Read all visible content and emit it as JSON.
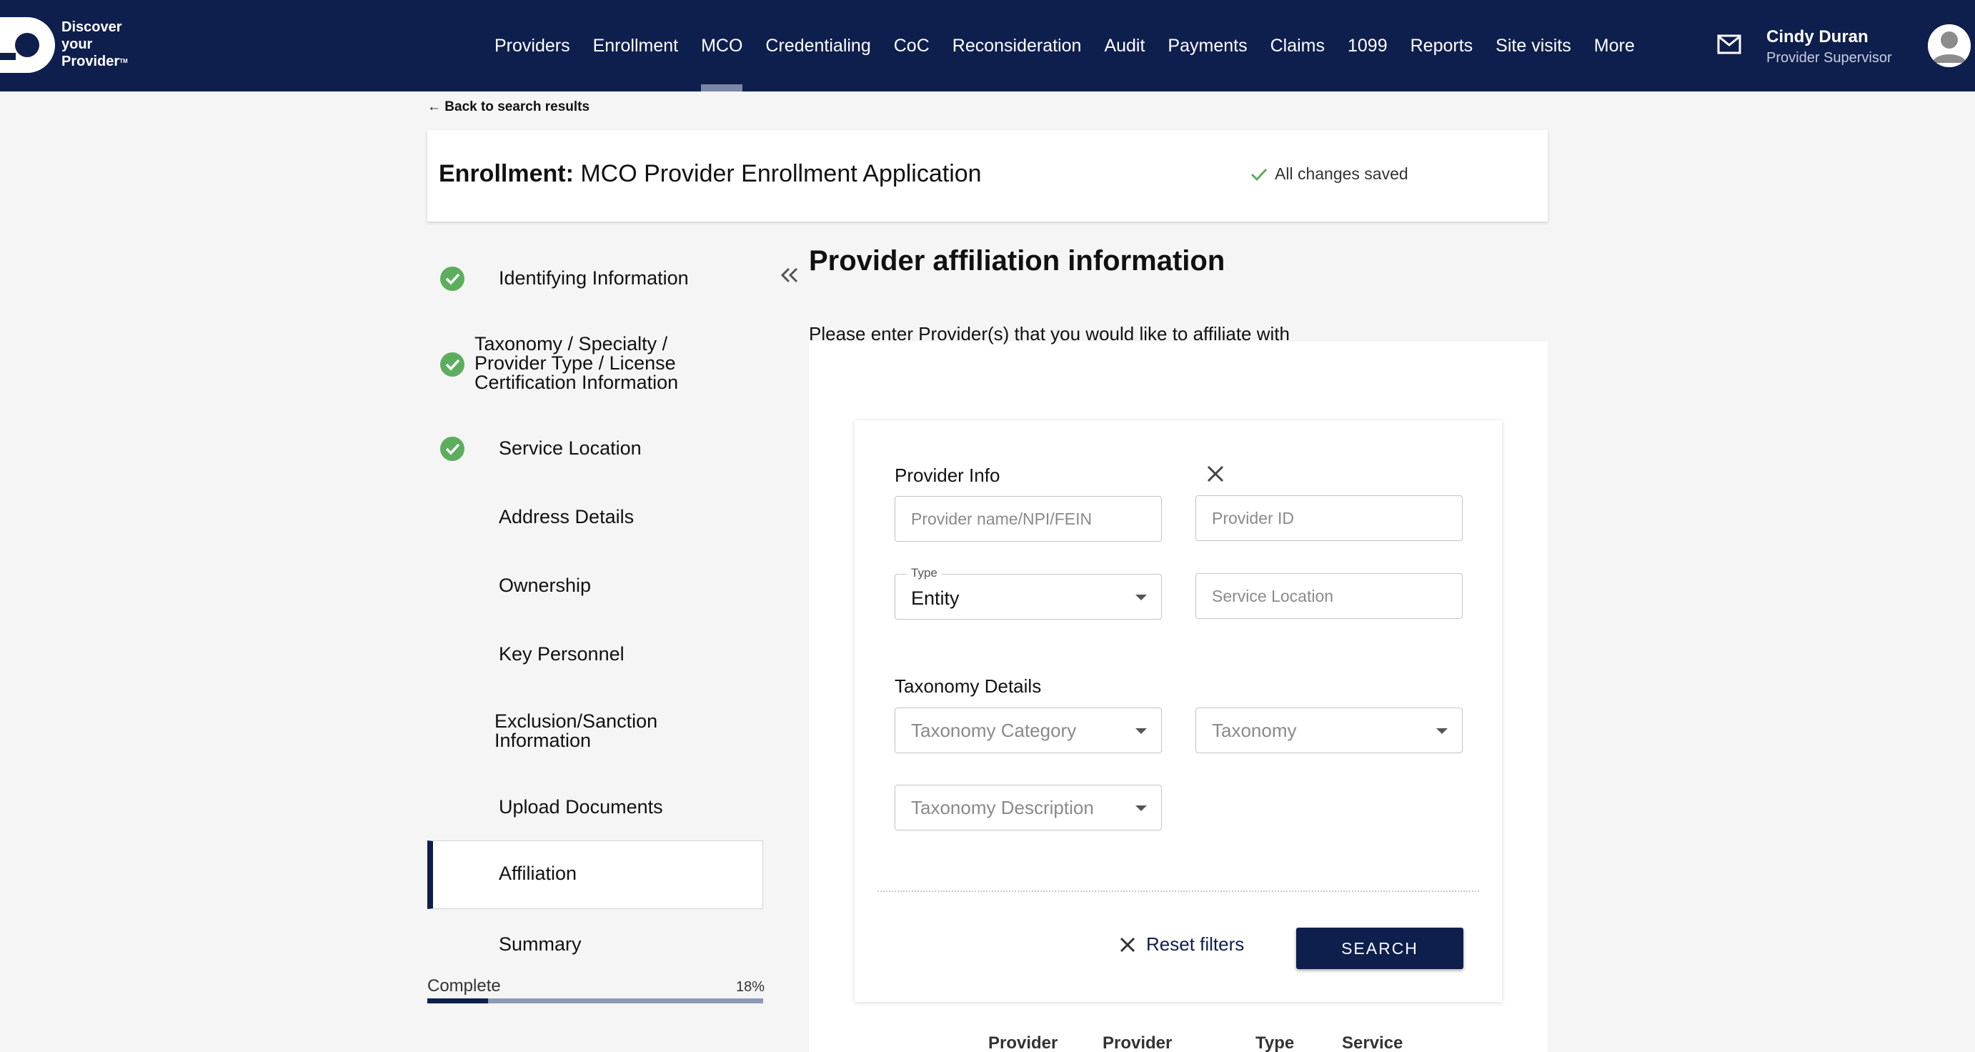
{
  "brand": {
    "line1": "Discover",
    "line2": "your",
    "line3": "Provider"
  },
  "nav": {
    "items": [
      "Providers",
      "Enrollment",
      "MCO",
      "Credentialing",
      "CoC",
      "Reconsideration",
      "Audit",
      "Payments",
      "Claims",
      "1099",
      "Reports",
      "Site visits",
      "More"
    ],
    "active": "MCO"
  },
  "user": {
    "name": "Cindy Duran",
    "role": "Provider Supervisor"
  },
  "page": {
    "back_link": "← Back to search results",
    "title_prefix": "Enrollment:",
    "title": "MCO Provider Enrollment Application",
    "saved_status": "All changes saved"
  },
  "steps": [
    {
      "label": "Identifying Information",
      "complete": true
    },
    {
      "label": "Taxonomy / Specialty / Provider Type / License Certification Information",
      "complete": true
    },
    {
      "label": "Service Location",
      "complete": true
    },
    {
      "label": "Address Details",
      "complete": false
    },
    {
      "label": "Ownership",
      "complete": false
    },
    {
      "label": "Key Personnel",
      "complete": false
    },
    {
      "label": "Exclusion/Sanction Information",
      "complete": false
    },
    {
      "label": "Upload Documents",
      "complete": false
    },
    {
      "label": "Affiliation",
      "complete": false,
      "active": true
    },
    {
      "label": "Summary",
      "complete": false
    }
  ],
  "progress": {
    "label": "Complete",
    "percent_text": "18%",
    "fraction": 0.18
  },
  "section": {
    "title": "Provider affiliation information",
    "subtitle": "Please enter Provider(s) that you would like to affiliate with"
  },
  "filters": {
    "provider_info_label": "Provider Info",
    "provider_name_placeholder": "Provider name/NPI/FEIN",
    "provider_id_placeholder": "Provider ID",
    "type_legend": "Type",
    "type_value": "Entity",
    "service_location_placeholder": "Service Location",
    "taxonomy_details_label": "Taxonomy Details",
    "taxonomy_category_placeholder": "Taxonomy Category",
    "taxonomy_placeholder": "Taxonomy",
    "taxonomy_description_placeholder": "Taxonomy Description",
    "reset_label": "Reset filters",
    "search_label": "SEARCH"
  },
  "results_columns": [
    "Provider",
    "Provider",
    "Type",
    "Service"
  ],
  "colors": {
    "navy": "#0e1f4d",
    "check_green": "#5cae5e",
    "nav_indicator": "#7c86a6"
  }
}
